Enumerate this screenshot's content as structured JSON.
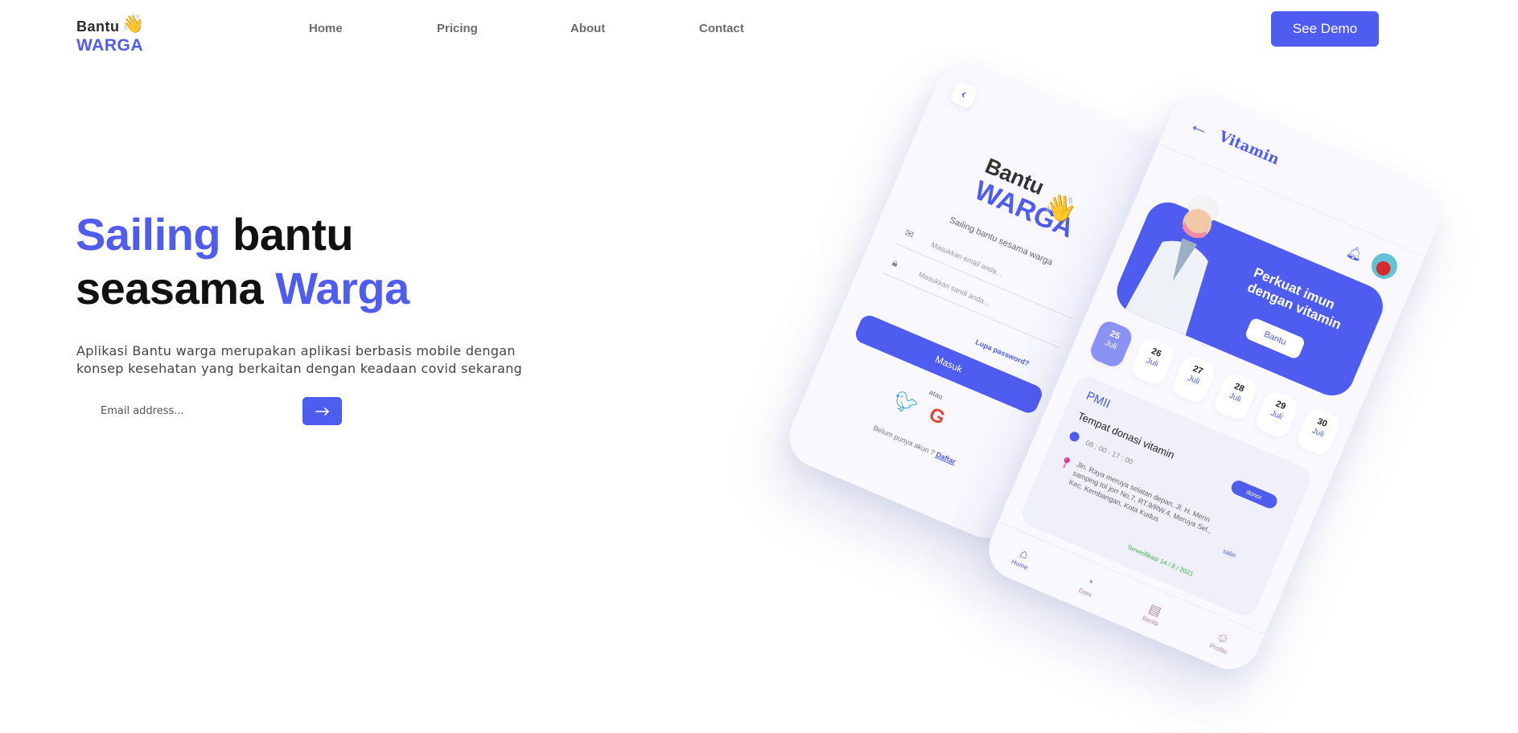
{
  "brand": {
    "line1": "Bantu",
    "line2": "WARGA",
    "accent_color": "#4f5cf0"
  },
  "nav": {
    "items": [
      {
        "label": "Home"
      },
      {
        "label": "Pricing"
      },
      {
        "label": "About"
      },
      {
        "label": "Contact"
      }
    ],
    "cta_label": "See Demo"
  },
  "hero": {
    "title_part1": "Sailing",
    "title_part2": " bantu",
    "title_part3": "seasama ",
    "title_part4": "Warga",
    "description": "Aplikasi Bantu warga merupakan aplikasi berbasis mobile dengan konsep kesehatan yang berkaitan dengan keadaan covid sekarang",
    "email_placeholder": "Email address...",
    "submit_icon": "arrow-right-icon"
  },
  "mockup_login": {
    "logo_line1": "Bantu",
    "logo_line2": "WARGA",
    "tagline": "Sailing bantu sesama warga",
    "email_placeholder": "Masukkan email anda...",
    "password_placeholder": "Masukkan sandi anda...",
    "forgot": "Lupa password?",
    "login_button": "Masuk",
    "or": "atau",
    "signup_text": "Belum punya akun ?",
    "signup_link": "Daftar"
  },
  "mockup_vitamin": {
    "title": "Vitamin",
    "banner_text": "Perkuat imun dengan vitamin",
    "banner_button": "Bantu",
    "dates": [
      {
        "day": "25",
        "month": "Juli",
        "active": true
      },
      {
        "day": "26",
        "month": "Juli"
      },
      {
        "day": "27",
        "month": "Juli"
      },
      {
        "day": "28",
        "month": "Juli"
      },
      {
        "day": "29",
        "month": "Juli"
      },
      {
        "day": "30",
        "month": "Juli"
      }
    ],
    "card": {
      "org": "PMII",
      "place": "Tempat donasi vitamin",
      "donor_label": "donor",
      "time": "08 : 00 - 17 : 00",
      "address": "Jln. Raya meruya selatan depan, Jl. H. Merin samping tol jorr No.7, RT.9/RW.4, Meruya Sel., Kec. Kembangan, Kota Kudus",
      "copy_label": "salin",
      "verified": "Terverifikasi 14 / 8 / 2021"
    },
    "bottom_nav": [
      {
        "label": "Home",
        "icon": "home-icon"
      },
      {
        "label": "Data",
        "icon": "chart-icon"
      },
      {
        "label": "Berita",
        "icon": "news-icon"
      },
      {
        "label": "Profile",
        "icon": "user-icon"
      }
    ]
  }
}
